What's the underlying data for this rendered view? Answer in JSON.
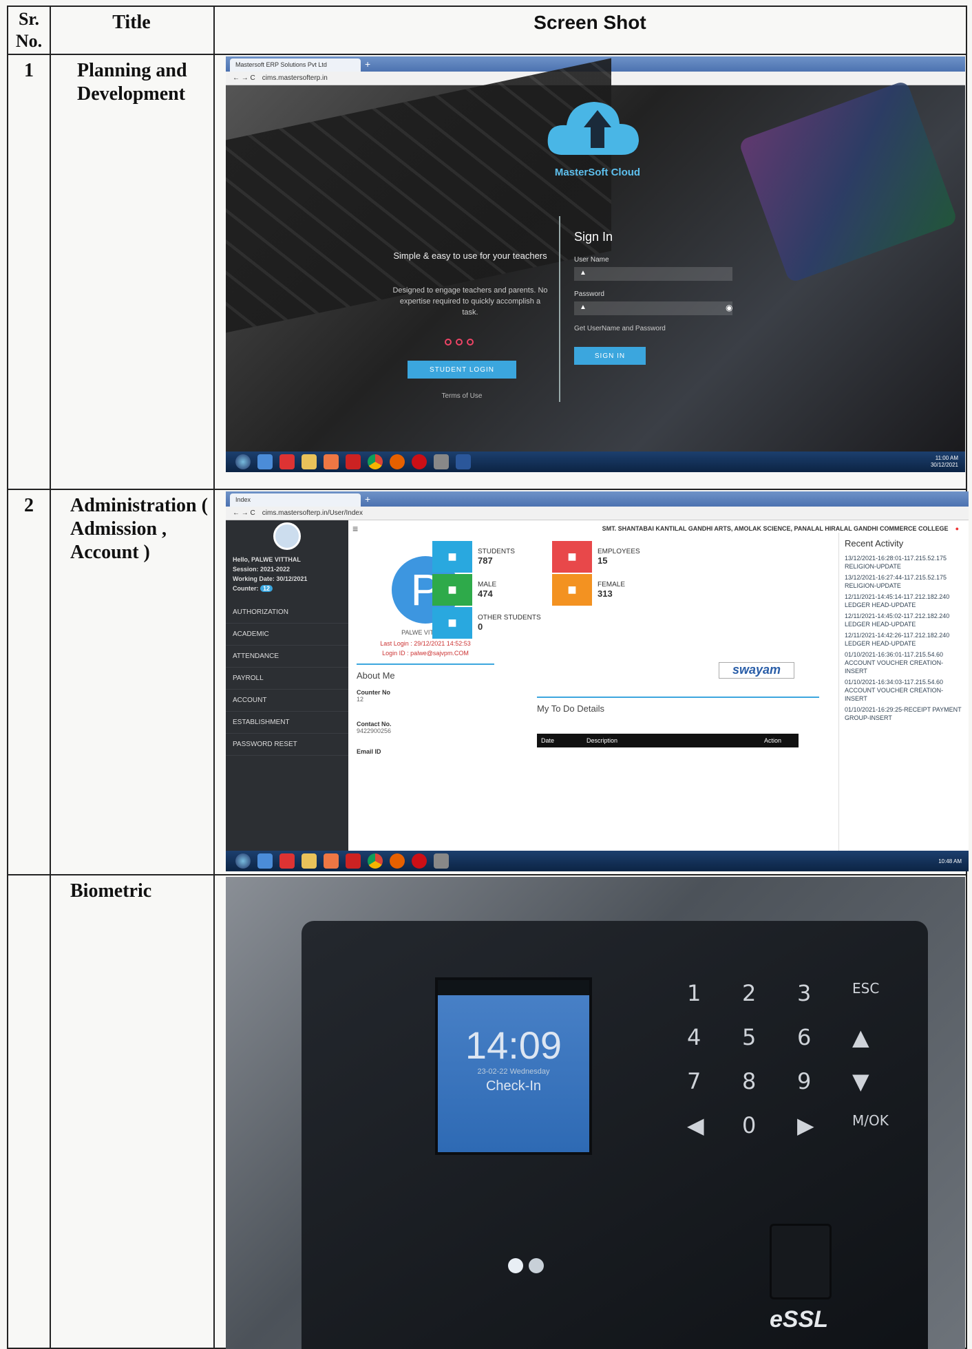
{
  "table": {
    "headers": {
      "sr": "Sr.\nNo.",
      "title": "Title",
      "shot": "Screen Shot"
    },
    "rows": [
      {
        "sr": "1",
        "title": "Planning and Development"
      },
      {
        "sr": "2",
        "title": "Administration ( Admission , Account )"
      },
      {
        "sr": "",
        "title": "Biometric"
      }
    ]
  },
  "shot1": {
    "tab": "Mastersoft ERP Solutions Pvt Ltd",
    "url": "cims.mastersofterp.in",
    "brand": "MasterSoft Cloud",
    "tagline": "Simple & easy to use for your teachers",
    "desc": "Designed to engage teachers and parents. No expertise required to quickly accomplish a task.",
    "student_login": "STUDENT LOGIN",
    "terms": "Terms of Use",
    "signin_title": "Sign In",
    "username_label": "User Name",
    "password_label": "Password",
    "forgot": "Get UserName and Password",
    "signin_btn": "SIGN IN",
    "clock": "11:00 AM",
    "date": "30/12/2021"
  },
  "shot2": {
    "tab": "Index",
    "url": "cims.mastersofterp.in/User/Index",
    "college": "SMT. SHANTABAI KANTILAL GANDHI ARTS, AMOLAK SCIENCE, PANALAL HIRALAL GANDHI COMMERCE COLLEGE",
    "hello": "Hello, PALWE VITTHAL",
    "session": "Session: 2021-2022",
    "working": "Working Date: 30/12/2021",
    "counter": "Counter:",
    "counter_badge": "12",
    "menu": [
      "AUTHORIZATION",
      "ACADEMIC",
      "ATTENDANCE",
      "PAYROLL",
      "ACCOUNT",
      "ESTABLISHMENT",
      "PASSWORD RESET"
    ],
    "avatar_letter": "P",
    "profile_name": "PALWE VITTHAL",
    "last_login": "Last Login : 29/12/2021 14:52:53",
    "login_id": "Login ID : palwe@sajvpm.COM",
    "about": "About Me",
    "counter_no_label": "Counter No",
    "counter_no": "12",
    "contact_label": "Contact No.",
    "contact": "9422900256",
    "email_label": "Email ID",
    "stats": [
      {
        "label": "STUDENTS",
        "value": "787",
        "color": "#29a8df"
      },
      {
        "label": "EMPLOYEES",
        "value": "15",
        "color": "#e8484a"
      },
      {
        "label": "MALE",
        "value": "474",
        "color": "#2eaa4a"
      },
      {
        "label": "FEMALE",
        "value": "313",
        "color": "#f39221"
      },
      {
        "label": "OTHER STUDENTS",
        "value": "0",
        "color": "#29a8df"
      }
    ],
    "swayam": "swayam",
    "todo": "My To Do Details",
    "todo_cols": [
      "Date",
      "Description",
      "Action"
    ],
    "recent_title": "Recent Activity",
    "recent": [
      "13/12/2021-16:28:01-117.215.52.175 RELIGION-UPDATE",
      "13/12/2021-16:27:44-117.215.52.175 RELIGION-UPDATE",
      "12/11/2021-14:45:14-117.212.182.240 LEDGER HEAD-UPDATE",
      "12/11/2021-14:45:02-117.212.182.240 LEDGER HEAD-UPDATE",
      "12/11/2021-14:42:26-117.212.182.240 LEDGER HEAD-UPDATE",
      "01/10/2021-16:36:01-117.215.54.60 ACCOUNT VOUCHER CREATION-INSERT",
      "01/10/2021-16:34:03-117.215.54.60 ACCOUNT VOUCHER CREATION-INSERT",
      "01/10/2021-16:29:25-RECEIPT PAYMENT GROUP-INSERT"
    ],
    "clock": "10:48 AM"
  },
  "shot3": {
    "time": "14:09",
    "date": "23-02-22 Wednesday",
    "status": "Check-In",
    "keys": [
      "1",
      "2",
      "3",
      "ESC",
      "4",
      "5",
      "6",
      "▲",
      "7",
      "8",
      "9",
      "▼",
      "◀",
      "0",
      "▶",
      "M/OK"
    ],
    "brand": "eSSL"
  }
}
